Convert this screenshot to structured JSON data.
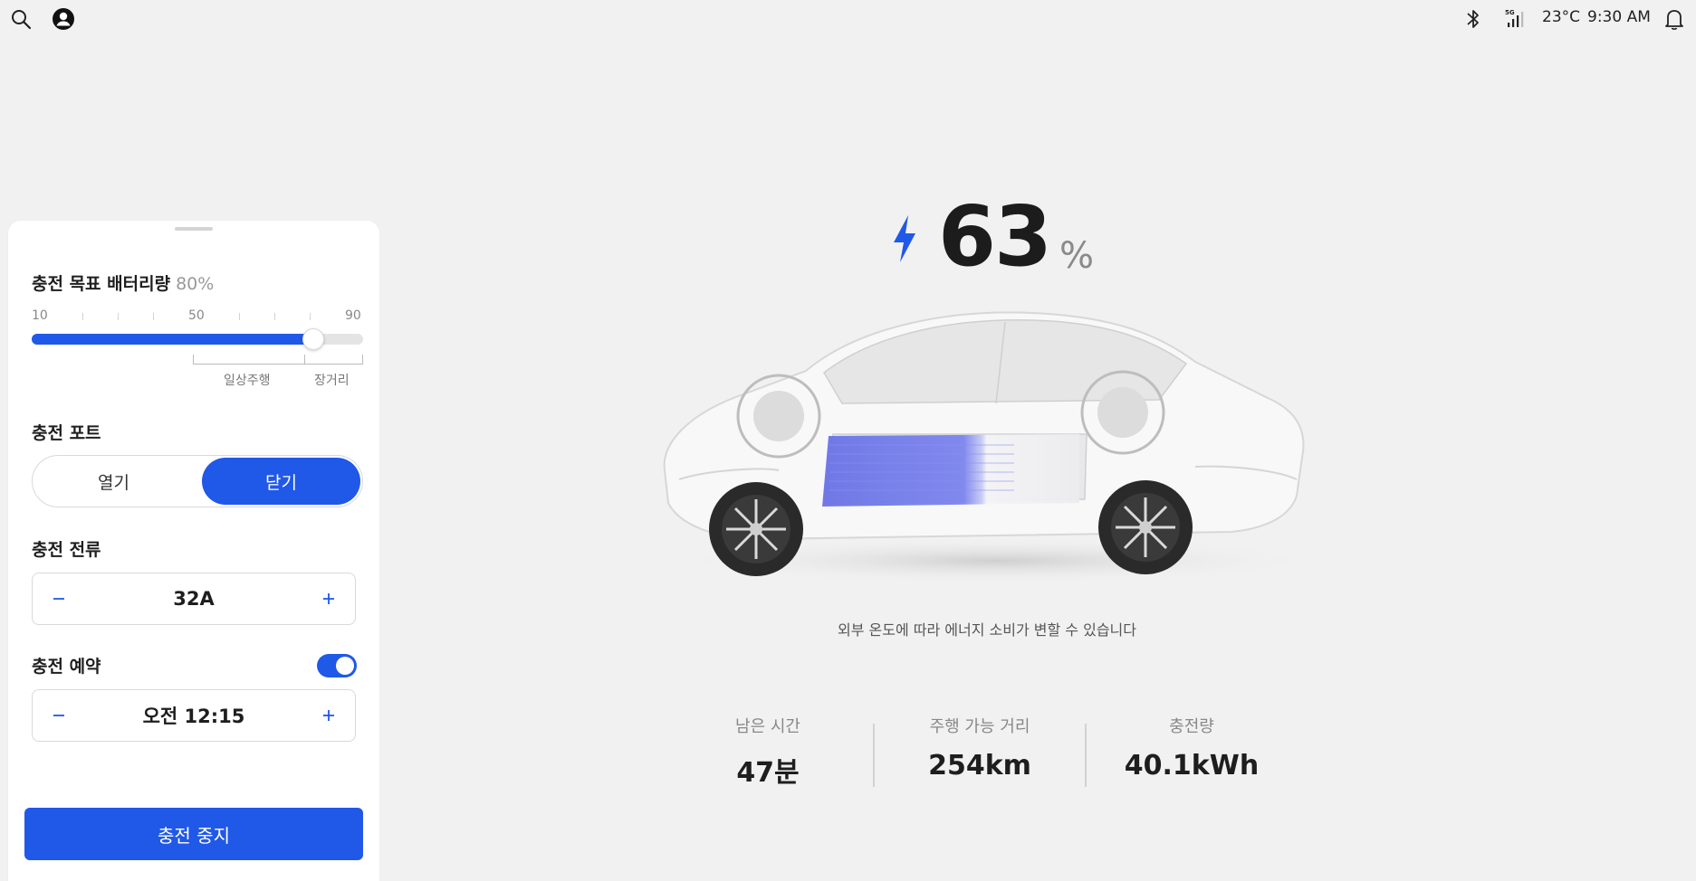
{
  "status_bar": {
    "temperature": "23°C",
    "time": "9:30 AM",
    "network": "5G"
  },
  "charge_panel": {
    "target": {
      "title": "충전 목표 배터리량",
      "value": "80%",
      "value_fraction": 0.85,
      "ticks": [
        "10",
        "50",
        "90"
      ],
      "range_daily": "일상주행",
      "range_long": "장거리"
    },
    "port": {
      "title": "충전 포트",
      "open_label": "열기",
      "close_label": "닫기",
      "selected": "닫기"
    },
    "current": {
      "title": "충전 전류",
      "value": "32A"
    },
    "schedule": {
      "title": "충전 예약",
      "enabled": true,
      "value": "오전 12:15"
    },
    "stop_label": "충전 중지"
  },
  "battery": {
    "percent": "63",
    "unit": "%"
  },
  "note": "외부 온도에 따라 에너지 소비가 변할 수 있습니다",
  "stats": [
    {
      "label": "남은 시간",
      "value": "47분"
    },
    {
      "label": "주행 가능 거리",
      "value": "254km"
    },
    {
      "label": "충전량",
      "value": "40.1kWh"
    }
  ],
  "colors": {
    "accent": "#2058e8",
    "background": "#f1f1f1",
    "panel": "#ffffff"
  },
  "icons": [
    "search-icon",
    "profile-icon",
    "bluetooth-icon",
    "signal-5g-icon",
    "bell-icon",
    "bolt-icon"
  ]
}
